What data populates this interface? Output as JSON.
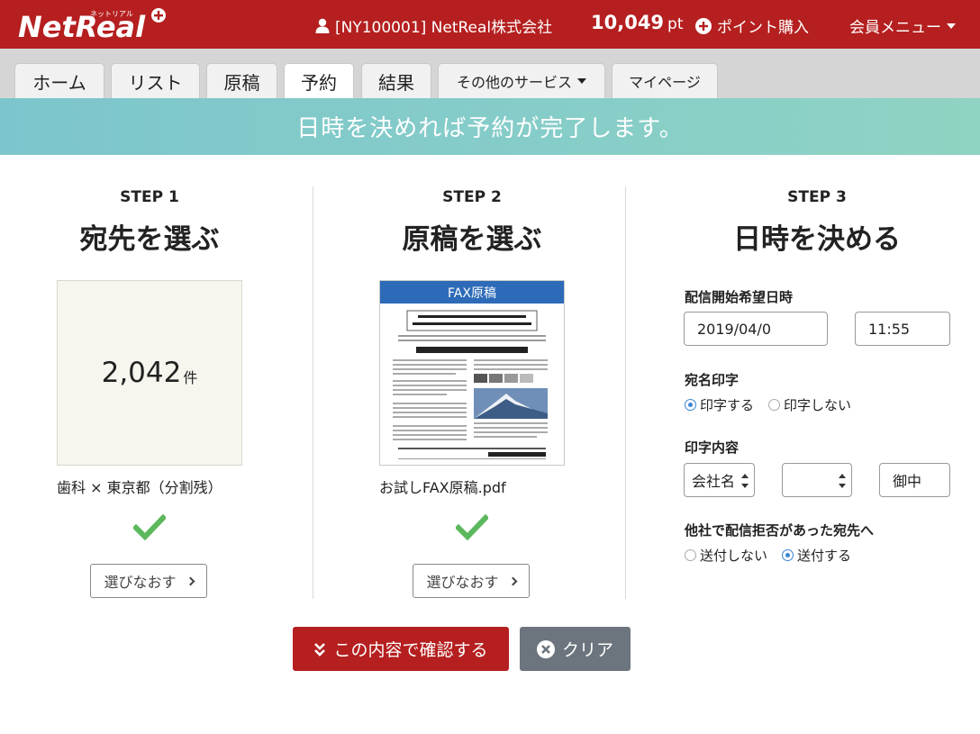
{
  "header": {
    "logo_text": "NetReal",
    "logo_sub": "ネットリアル",
    "user_label": "[NY100001] NetReal株式会社",
    "points_value": "10,049",
    "points_unit": "pt",
    "buy_points_label": "ポイント購入",
    "member_menu_label": "会員メニュー"
  },
  "tabs": [
    {
      "label": "ホーム",
      "active": false
    },
    {
      "label": "リスト",
      "active": false
    },
    {
      "label": "原稿",
      "active": false
    },
    {
      "label": "予約",
      "active": true
    },
    {
      "label": "結果",
      "active": false
    },
    {
      "label": "その他のサービス",
      "active": false
    },
    {
      "label": "マイページ",
      "active": false
    }
  ],
  "banner": {
    "text": "日時を決めれば予約が完了します。"
  },
  "step1": {
    "label": "STEP 1",
    "title": "宛先を選ぶ",
    "count": "2,042",
    "count_unit": "件",
    "caption": "歯科 × 東京都（分割残）",
    "redo_label": "選びなおす"
  },
  "step2": {
    "label": "STEP 2",
    "title": "原稿を選ぶ",
    "thumb_header": "FAX原稿",
    "caption": "お試しFAX原稿.pdf",
    "redo_label": "選びなおす"
  },
  "step3": {
    "label": "STEP 3",
    "title": "日時を決める",
    "datetime_label": "配信開始希望日時",
    "date_value": "2019/04/0",
    "time_value": "11:55",
    "print_name_label": "宛名印字",
    "print_yes": "印字する",
    "print_no": "印字しない",
    "print_content_label": "印字内容",
    "select_company": "会社名",
    "select_blank": "",
    "honorific_value": "御中",
    "reject_label": "他社で配信拒否があった宛先へ",
    "send_no": "送付しない",
    "send_yes": "送付する"
  },
  "actions": {
    "confirm_label": "この内容で確認する",
    "clear_label": "クリア"
  },
  "colors": {
    "header_red": "#b51f1f",
    "banner_teal": "#86cdc9",
    "check_green": "#5cb85c",
    "radio_blue": "#3a86d6",
    "clear_gray": "#6c757d"
  }
}
